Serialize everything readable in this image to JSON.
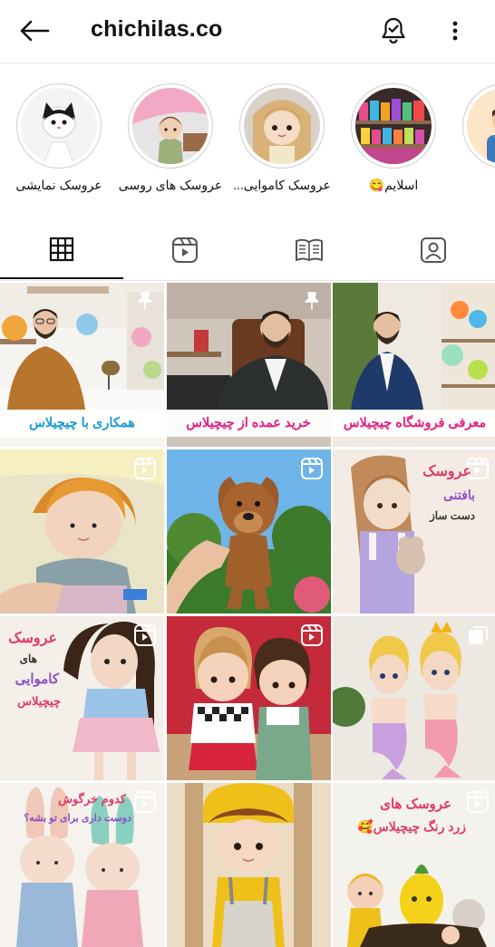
{
  "header": {
    "username": "chichilas.co"
  },
  "highlights": [
    {
      "label": "عروسک نمایشی"
    },
    {
      "label": "عروسک های روسی"
    },
    {
      "label": "عروسک کاموایی..."
    },
    {
      "label": "اسلایم😋"
    },
    {
      "label": "ه ما"
    }
  ],
  "posts": {
    "p1": {
      "caption": "همکاری با چیچیلاس"
    },
    "p2": {
      "caption": "خرید عمده از چیچیلاس"
    },
    "p3": {
      "caption": "معرفی فروشگاه چیچیلاس"
    },
    "p6": {
      "line1": "عروسک",
      "line2": "بافتنی",
      "line3": "دست ساز"
    },
    "p7": {
      "line1": "عروسک",
      "line2": "های",
      "line3": "کاموایی",
      "line4": "چیچیلاس"
    },
    "p10": {
      "line1": "کدوم خرگوش",
      "line2": "دوست داری برای تو بشه؟"
    },
    "p12": {
      "line1": "عروسک های",
      "line2": "زرد رنگ چیچیلاس🥰"
    }
  }
}
